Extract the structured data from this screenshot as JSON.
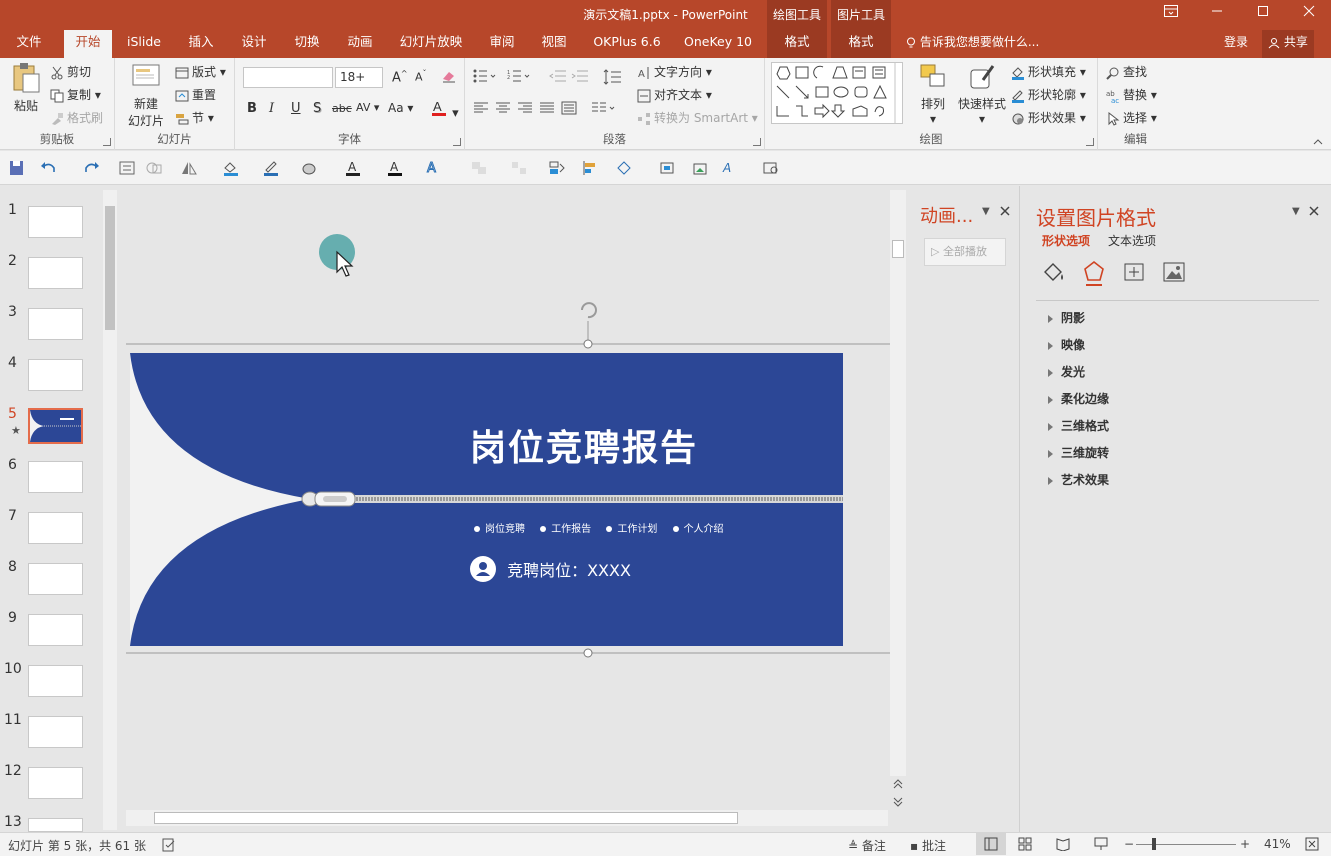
{
  "window": {
    "title": "演示文稿1.pptx - PowerPoint",
    "context_tabs": [
      {
        "group": "绘图工具",
        "tab": "格式"
      },
      {
        "group": "图片工具",
        "tab": "格式"
      }
    ]
  },
  "tabs": [
    "文件",
    "开始",
    "iSlide",
    "插入",
    "设计",
    "切换",
    "动画",
    "幻灯片放映",
    "审阅",
    "视图",
    "OKPlus 6.6",
    "OneKey 10"
  ],
  "active_tab": "开始",
  "tell_me": "告诉我您想要做什么...",
  "account": {
    "login": "登录",
    "share": "共享"
  },
  "ribbon": {
    "clipboard": {
      "label": "剪贴板",
      "paste": "粘贴",
      "cut": "剪切",
      "copy": "复制",
      "format_painter": "格式刷"
    },
    "slides": {
      "label": "幻灯片",
      "new_slide_line1": "新建",
      "new_slide_line2": "幻灯片",
      "layout": "版式",
      "reset": "重置",
      "section": "节"
    },
    "font": {
      "label": "字体",
      "font_name": "",
      "font_size": "18+",
      "bold": "B",
      "italic": "I",
      "underline": "U",
      "shadow": "S",
      "strike": "abc",
      "spacing": "AV",
      "case": "Aa"
    },
    "paragraph": {
      "label": "段落",
      "text_direction": "文字方向",
      "align_text": "对齐文本",
      "convert_smartart": "转换为 SmartArt"
    },
    "drawing": {
      "label": "绘图",
      "arrange": "排列",
      "quick_styles": "快速样式",
      "shape_fill": "形状填充",
      "shape_outline": "形状轮廓",
      "shape_effects": "形状效果"
    },
    "editing": {
      "label": "编辑",
      "find": "查找",
      "replace": "替换",
      "select": "选择"
    }
  },
  "thumbnails": [
    "1",
    "2",
    "3",
    "4",
    "5",
    "6",
    "7",
    "8",
    "9",
    "10",
    "11",
    "12",
    "13"
  ],
  "selected_slide": "5",
  "slide": {
    "title": "岗位竞聘报告",
    "bullets": [
      "岗位竞聘",
      "工作报告",
      "工作计划",
      "个人介绍"
    ],
    "position_line": "竞聘岗位：XXXX",
    "colors": {
      "background": "#2c4796",
      "left_shape": "#f2f2f2"
    }
  },
  "animation_pane": {
    "title": "动画...",
    "play_all": "全部播放"
  },
  "format_pane": {
    "title": "设置图片格式",
    "tabs": [
      "形状选项",
      "文本选项"
    ],
    "active_tab": "形状选项",
    "icons": [
      "fill-line-icon",
      "effects-icon",
      "size-properties-icon",
      "picture-icon"
    ],
    "sections": [
      "阴影",
      "映像",
      "发光",
      "柔化边缘",
      "三维格式",
      "三维旋转",
      "艺术效果"
    ]
  },
  "status": {
    "slide_info": "幻灯片 第 5 张，共 61 张",
    "notes": "备注",
    "comments": "批注",
    "zoom": "41%"
  },
  "colors": {
    "accent": "#b7472a",
    "context_tab": "#9b3a22"
  }
}
